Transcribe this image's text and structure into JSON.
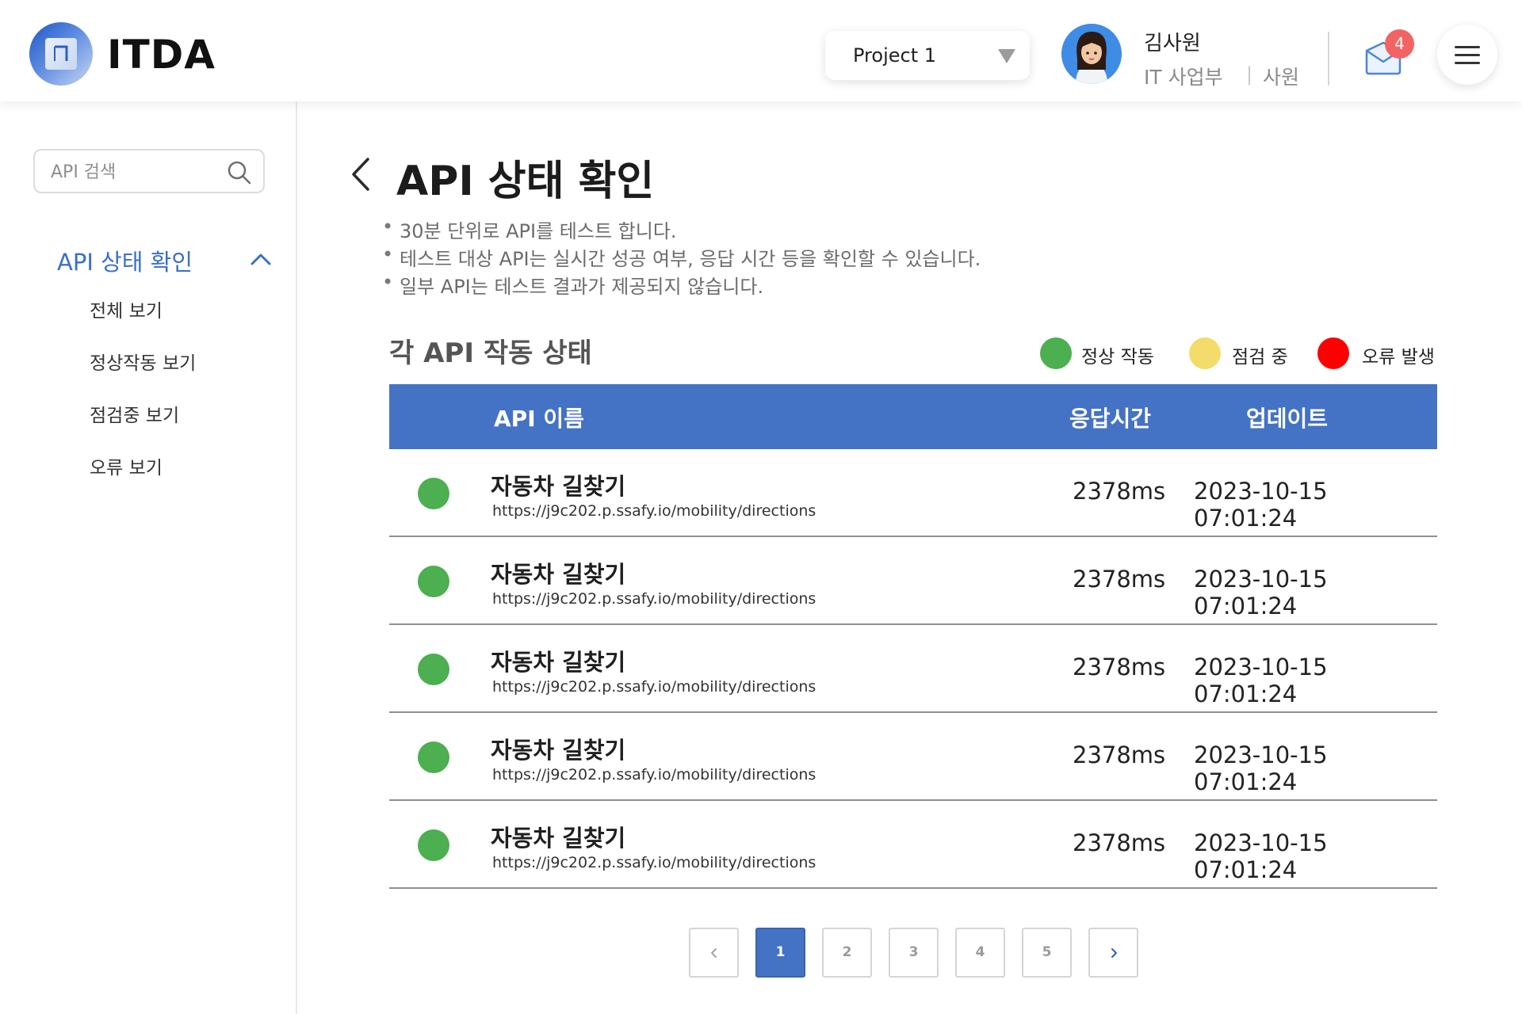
{
  "header": {
    "logo_text": "ITDA",
    "project": "Project 1",
    "user": {
      "name": "김사원",
      "department": "IT 사업부",
      "separator": "|",
      "role": "사원"
    },
    "mail_count": "4"
  },
  "sidebar": {
    "search_placeholder": "API 검색",
    "section_title": "API 상태 확인",
    "items": [
      "전체 보기",
      "정상작동 보기",
      "점검중 보기",
      "오류 보기"
    ]
  },
  "main": {
    "title": "API 상태 확인",
    "descriptions": [
      "30분 단위로 API를 테스트 합니다.",
      "테스트 대상 API는 실시간 성공 여부, 응답 시간 등을 확인할 수 있습니다.",
      "일부 API는 테스트 결과가 제공되지 않습니다."
    ],
    "section_title": "각 API 작동 상태",
    "legend": [
      {
        "label": "정상 작동",
        "color": "#4caf50"
      },
      {
        "label": "점검 중",
        "color": "#f4dc6a"
      },
      {
        "label": "오류 발생",
        "color": "#ff0000"
      }
    ],
    "table": {
      "headers": {
        "name": "API 이름",
        "response": "응답시간",
        "updated": "업데이트"
      },
      "rows": [
        {
          "status": "정상 작동",
          "name": "자동차 길찾기",
          "url": "https://j9c202.p.ssafy.io/mobility/directions",
          "response": "2378ms",
          "updated": "2023-10-15 07:01:24"
        },
        {
          "status": "정상 작동",
          "name": "자동차 길찾기",
          "url": "https://j9c202.p.ssafy.io/mobility/directions",
          "response": "2378ms",
          "updated": "2023-10-15 07:01:24"
        },
        {
          "status": "정상 작동",
          "name": "자동차 길찾기",
          "url": "https://j9c202.p.ssafy.io/mobility/directions",
          "response": "2378ms",
          "updated": "2023-10-15 07:01:24"
        },
        {
          "status": "정상 작동",
          "name": "자동차 길찾기",
          "url": "https://j9c202.p.ssafy.io/mobility/directions",
          "response": "2378ms",
          "updated": "2023-10-15 07:01:24"
        },
        {
          "status": "정상 작동",
          "name": "자동차 길찾기",
          "url": "https://j9c202.p.ssafy.io/mobility/directions",
          "response": "2378ms",
          "updated": "2023-10-15 07:01:24"
        }
      ]
    },
    "pagination": {
      "pages": [
        "1",
        "2",
        "3",
        "4",
        "5"
      ],
      "current": "1"
    }
  }
}
